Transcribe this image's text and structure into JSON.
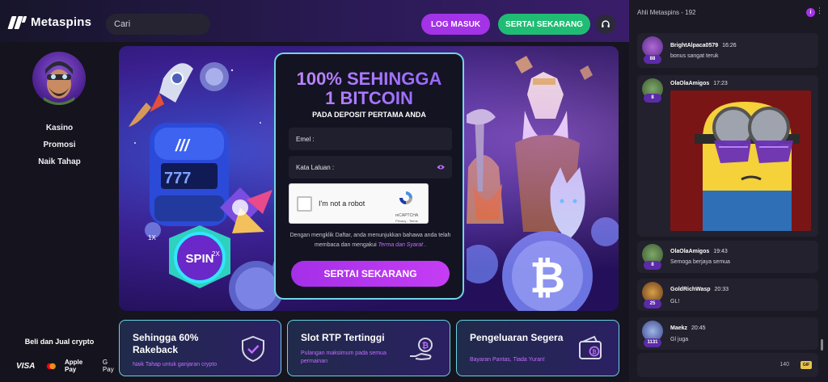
{
  "brand": {
    "name": "Metaspins"
  },
  "header": {
    "search_placeholder": "Cari",
    "login_label": "LOG MASUK",
    "join_label": "SERTAI SEKARANG"
  },
  "sidebar": {
    "items": [
      {
        "label": "Kasino"
      },
      {
        "label": "Promosi"
      },
      {
        "label": "Naik Tahap"
      }
    ],
    "crypto_label": "Beli dan Jual crypto",
    "payments": [
      "VISA",
      "Apple Pay",
      "G Pay"
    ]
  },
  "banner": {
    "art_badges": [
      "1X",
      "2X"
    ],
    "spin_label": "SPIN"
  },
  "registration": {
    "title_line1": "100% SEHINGGA",
    "title_line2": "1 BITCOIN",
    "subtitle": "PADA DEPOSIT PERTAMA ANDA",
    "email_placeholder": "Emel :",
    "password_placeholder": "Kata Laluan :",
    "captcha_label": "I'm not a robot",
    "captcha_brand": "reCAPTCHA",
    "captcha_terms": "Privacy - Terms",
    "terms_text": "Dengan mengklik Daftar, anda menunjukkan bahawa anda telah membaca dan mengakui",
    "terms_link": "Terma dan Syarat",
    "terms_end": ".",
    "join_label": "SERTAI SEKARANG"
  },
  "features": [
    {
      "title": "Sehingga 60% Rakeback",
      "desc": "Naik Tahap untuk ganjaran crypto",
      "icon": "shield-check-icon"
    },
    {
      "title": "Slot RTP Tertinggi",
      "desc": "Pulangan maksimum pada semua permainan",
      "icon": "bitcoin-hand-icon"
    },
    {
      "title": "Pengeluaran Segera",
      "desc": "Bayaran Pantas, Tiada Yuran!",
      "icon": "wallet-bitcoin-icon"
    }
  ],
  "chat": {
    "title": "Ahli Metaspins - 192",
    "char_count": "140",
    "gif_label": "GIF",
    "messages": [
      {
        "user": "BrightAlpaca0579",
        "time": "16:26",
        "level": "88",
        "text": "bonus sangat teruk"
      },
      {
        "user": "OlaOlaAmigos",
        "time": "17:23",
        "level": "8",
        "text": ""
      },
      {
        "user": "OlaOlaAmigos",
        "time": "19:43",
        "level": "8",
        "text": "Semoga berjaya semua"
      },
      {
        "user": "GoldRichWasp",
        "time": "20:33",
        "level": "25",
        "text": "GL!"
      },
      {
        "user": "Maekz",
        "time": "20:45",
        "level": "1131",
        "text": "Gl juga"
      }
    ]
  },
  "colors": {
    "accent_purple": "#a432e6",
    "accent_green": "#1fbd73",
    "card_border": "#6ad3e0",
    "link_purple": "#c46dff"
  }
}
